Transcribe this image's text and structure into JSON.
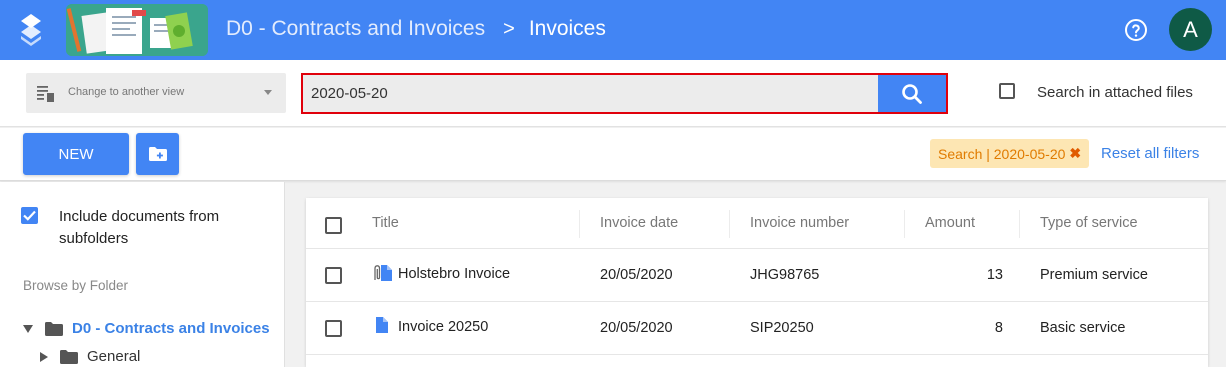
{
  "header": {
    "breadcrumb_parent": "D0 - Contracts and Invoices",
    "breadcrumb_separator": ">",
    "breadcrumb_current": "Invoices",
    "avatar_letter": "A",
    "color": "#4285f4"
  },
  "search": {
    "view_select_label": "Change to another view",
    "query": "2020-05-20",
    "attached_files_label": "Search in attached files",
    "attached_files_checked": false
  },
  "toolbar": {
    "new_label": "NEW",
    "filter_chip_label": "Search | 2020-05-20",
    "reset_label": "Reset all filters"
  },
  "sidebar": {
    "include_subfolders_label": "Include documents from subfolders",
    "include_subfolders_checked": true,
    "browse_label": "Browse by Folder",
    "tree": [
      {
        "label": "D0 - Contracts and Invoices",
        "expanded": true,
        "selected": true
      },
      {
        "label": "General",
        "expanded": false,
        "selected": false
      }
    ]
  },
  "table": {
    "columns": [
      "Title",
      "Invoice date",
      "Invoice number",
      "Amount",
      "Type of service"
    ],
    "rows": [
      {
        "title": "Holstebro Invoice",
        "invoice_date": "20/05/2020",
        "invoice_number": "JHG98765",
        "amount": "13",
        "type_of_service": "Premium service",
        "icon": "document-with-attachment-icon"
      },
      {
        "title": "Invoice 20250",
        "invoice_date": "20/05/2020",
        "invoice_number": "SIP20250",
        "amount": "8",
        "type_of_service": "Basic service",
        "icon": "document-icon"
      }
    ]
  }
}
